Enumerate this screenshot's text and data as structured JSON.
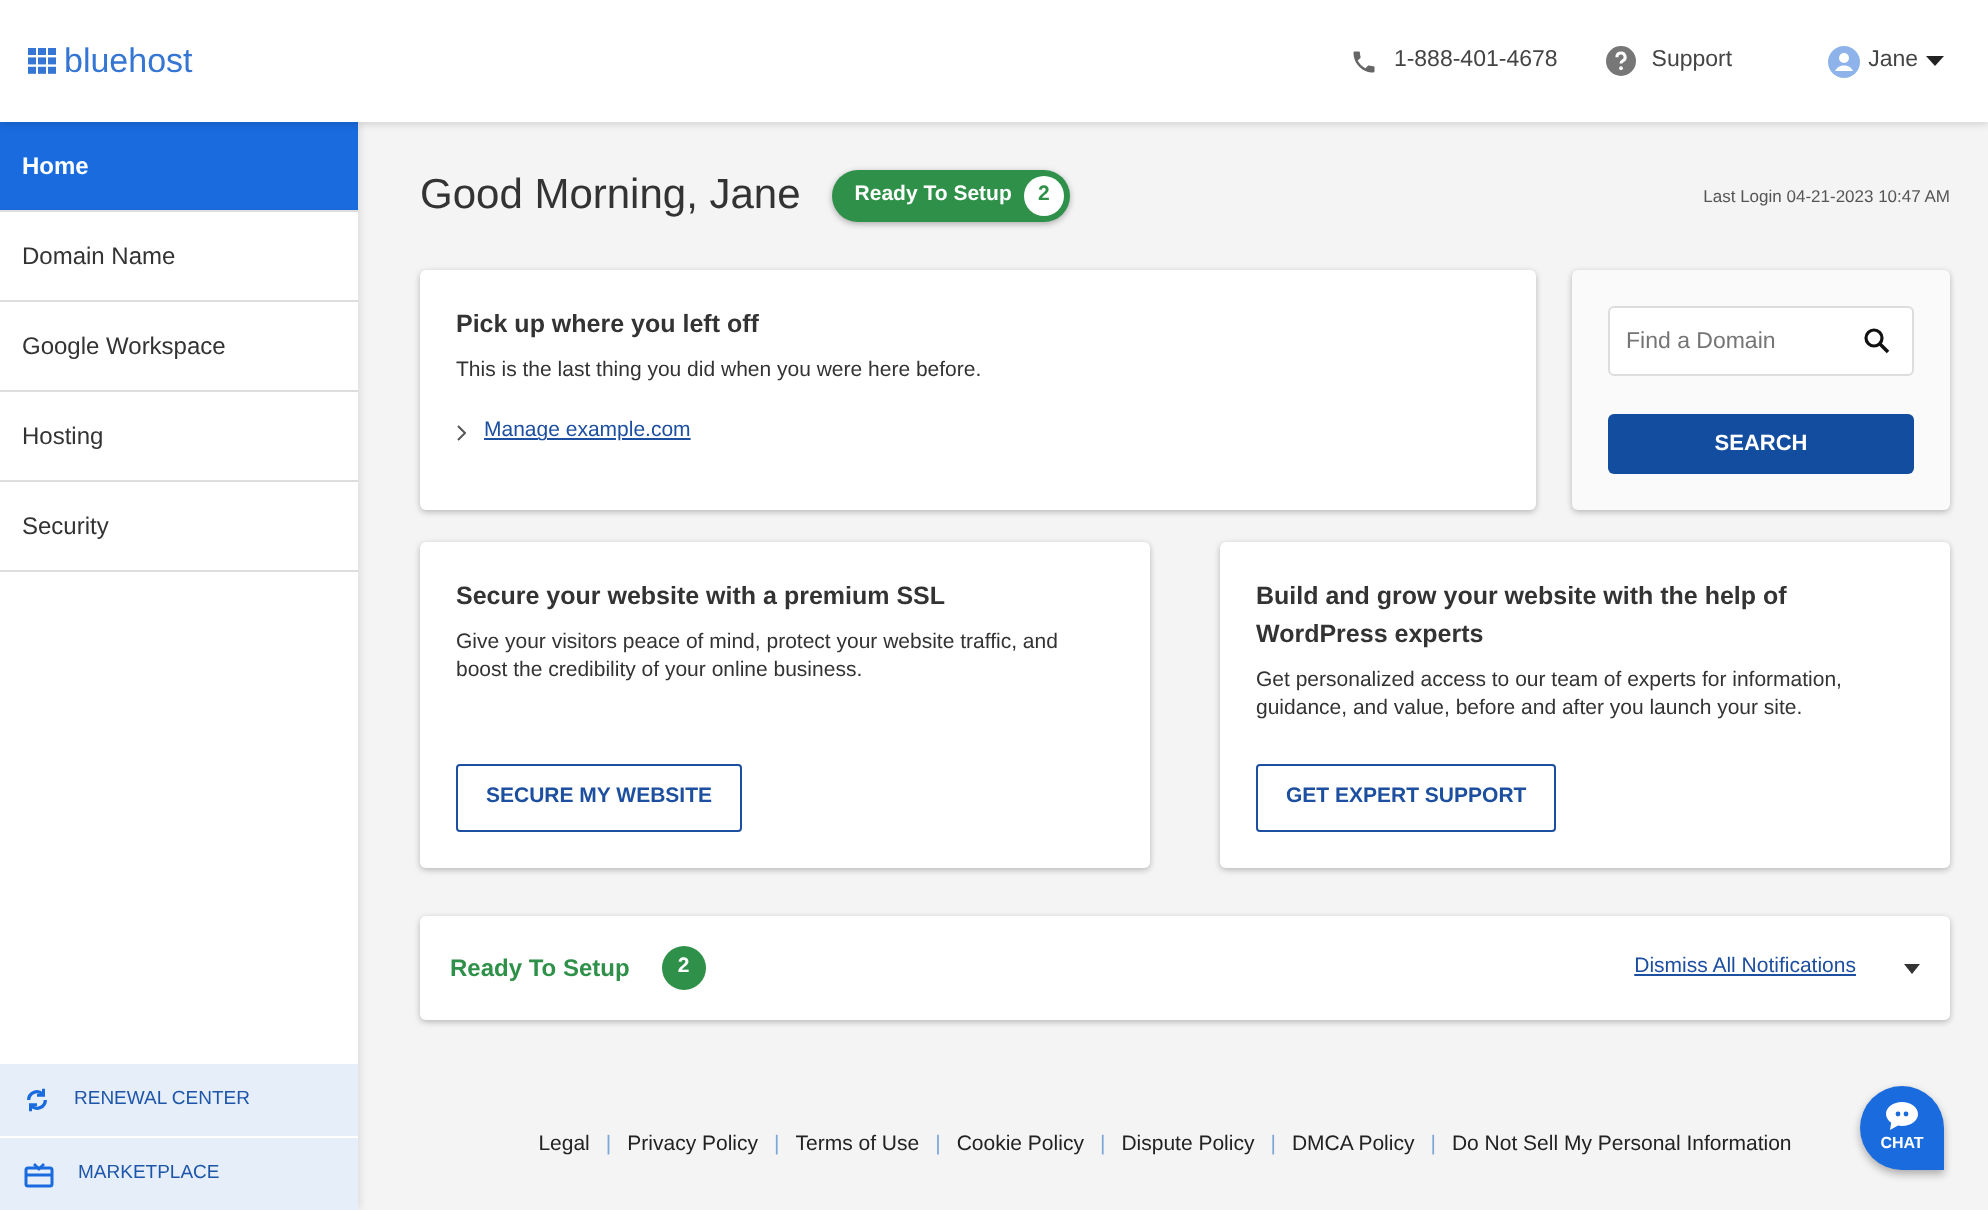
{
  "header": {
    "logo": "bluehost",
    "phone": "1-888-401-4678",
    "support": "Support",
    "user": "Jane"
  },
  "sidebar": {
    "items": [
      {
        "label": "Home",
        "selected": true
      },
      {
        "label": "Domain Name",
        "selected": false
      },
      {
        "label": "Google Workspace",
        "selected": false
      },
      {
        "label": "Hosting",
        "selected": false
      },
      {
        "label": "Security",
        "selected": false
      }
    ],
    "bottom_items": [
      {
        "label": "RENEWAL CENTER",
        "kind": "renewal"
      },
      {
        "label": "MARKETPLACE",
        "kind": "marketplace"
      }
    ]
  },
  "greeting": "Good Morning, Jane",
  "setup_badge": {
    "label": "Ready To Setup",
    "count": "2"
  },
  "last_login": "Last Login 04-21-2023 10:47 AM",
  "pickup": {
    "title": "Pick up where you left off",
    "text": "This is the last thing you did when you were here before.",
    "link": "Manage example.com"
  },
  "domain_search": {
    "placeholder": "Find a Domain",
    "button": "SEARCH"
  },
  "promos": [
    {
      "title": "Secure your website with a premium SSL",
      "text": "Give your visitors peace of mind, protect your website traffic, and boost the credibility of your online business.",
      "button": "SECURE MY WEBSITE"
    },
    {
      "title": "Build and grow your website with the help of WordPress experts",
      "text": "Get personalized access to our team of experts for information, guidance, and value, before and after you launch your site.",
      "button": "GET EXPERT SUPPORT"
    }
  ],
  "notifications": {
    "title": "Ready To Setup",
    "count": "2",
    "dismiss": "Dismiss All Notifications",
    "expanded": false
  },
  "footer_separator": "|",
  "footer_links": [
    "Legal",
    "Privacy Policy",
    "Terms of Use",
    "Cookie Policy",
    "Dispute Policy",
    "DMCA Policy",
    "Do Not Sell My Personal Information"
  ],
  "chat": "CHAT"
}
